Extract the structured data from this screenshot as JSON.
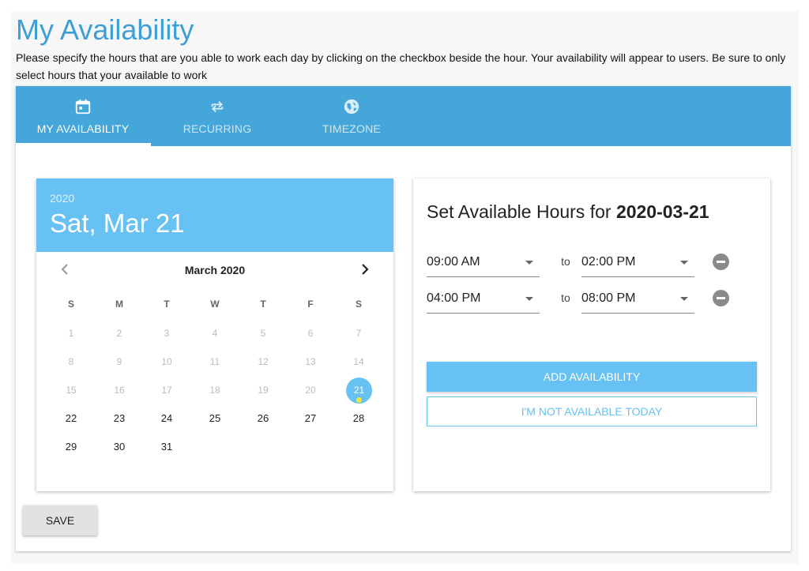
{
  "page": {
    "title": "My Availability",
    "intro": "Please specify the hours that are you able to work each day by clicking on the checkbox beside the hour. Your availability will appear to users. Be sure to only select hours that your available to work"
  },
  "tabs": [
    {
      "label": "MY AVAILABILITY",
      "icon": "calendar-icon",
      "active": true
    },
    {
      "label": "RECURRING",
      "icon": "repeat-icon",
      "active": false
    },
    {
      "label": "TIMEZONE",
      "icon": "globe-icon",
      "active": false
    }
  ],
  "picker": {
    "year": "2020",
    "date": "Sat, Mar 21",
    "month_label": "March 2020",
    "weekdays": [
      "S",
      "M",
      "T",
      "W",
      "T",
      "F",
      "S"
    ],
    "weeks": [
      [
        "1",
        "2",
        "3",
        "4",
        "5",
        "6",
        "7"
      ],
      [
        "8",
        "9",
        "10",
        "11",
        "12",
        "13",
        "14"
      ],
      [
        "15",
        "16",
        "17",
        "18",
        "19",
        "20",
        "21"
      ],
      [
        "22",
        "23",
        "24",
        "25",
        "26",
        "27",
        "28"
      ],
      [
        "29",
        "30",
        "31"
      ]
    ],
    "selected_day": "21"
  },
  "hours": {
    "title_prefix": "Set Available Hours for",
    "title_date": "2020-03-21",
    "to_label": "to",
    "slots": [
      {
        "start": "09:00 AM",
        "end": "02:00 PM"
      },
      {
        "start": "04:00 PM",
        "end": "08:00 PM"
      }
    ],
    "add_label": "ADD AVAILABILITY",
    "not_available_label": "I'M NOT AVAILABLE TODAY"
  },
  "save_label": "SAVE",
  "colors": {
    "title": "#3d9fd6",
    "tab_bar": "#44a6d9",
    "picker_header": "#67c1f2",
    "selected_dot": "#f5e53b"
  }
}
